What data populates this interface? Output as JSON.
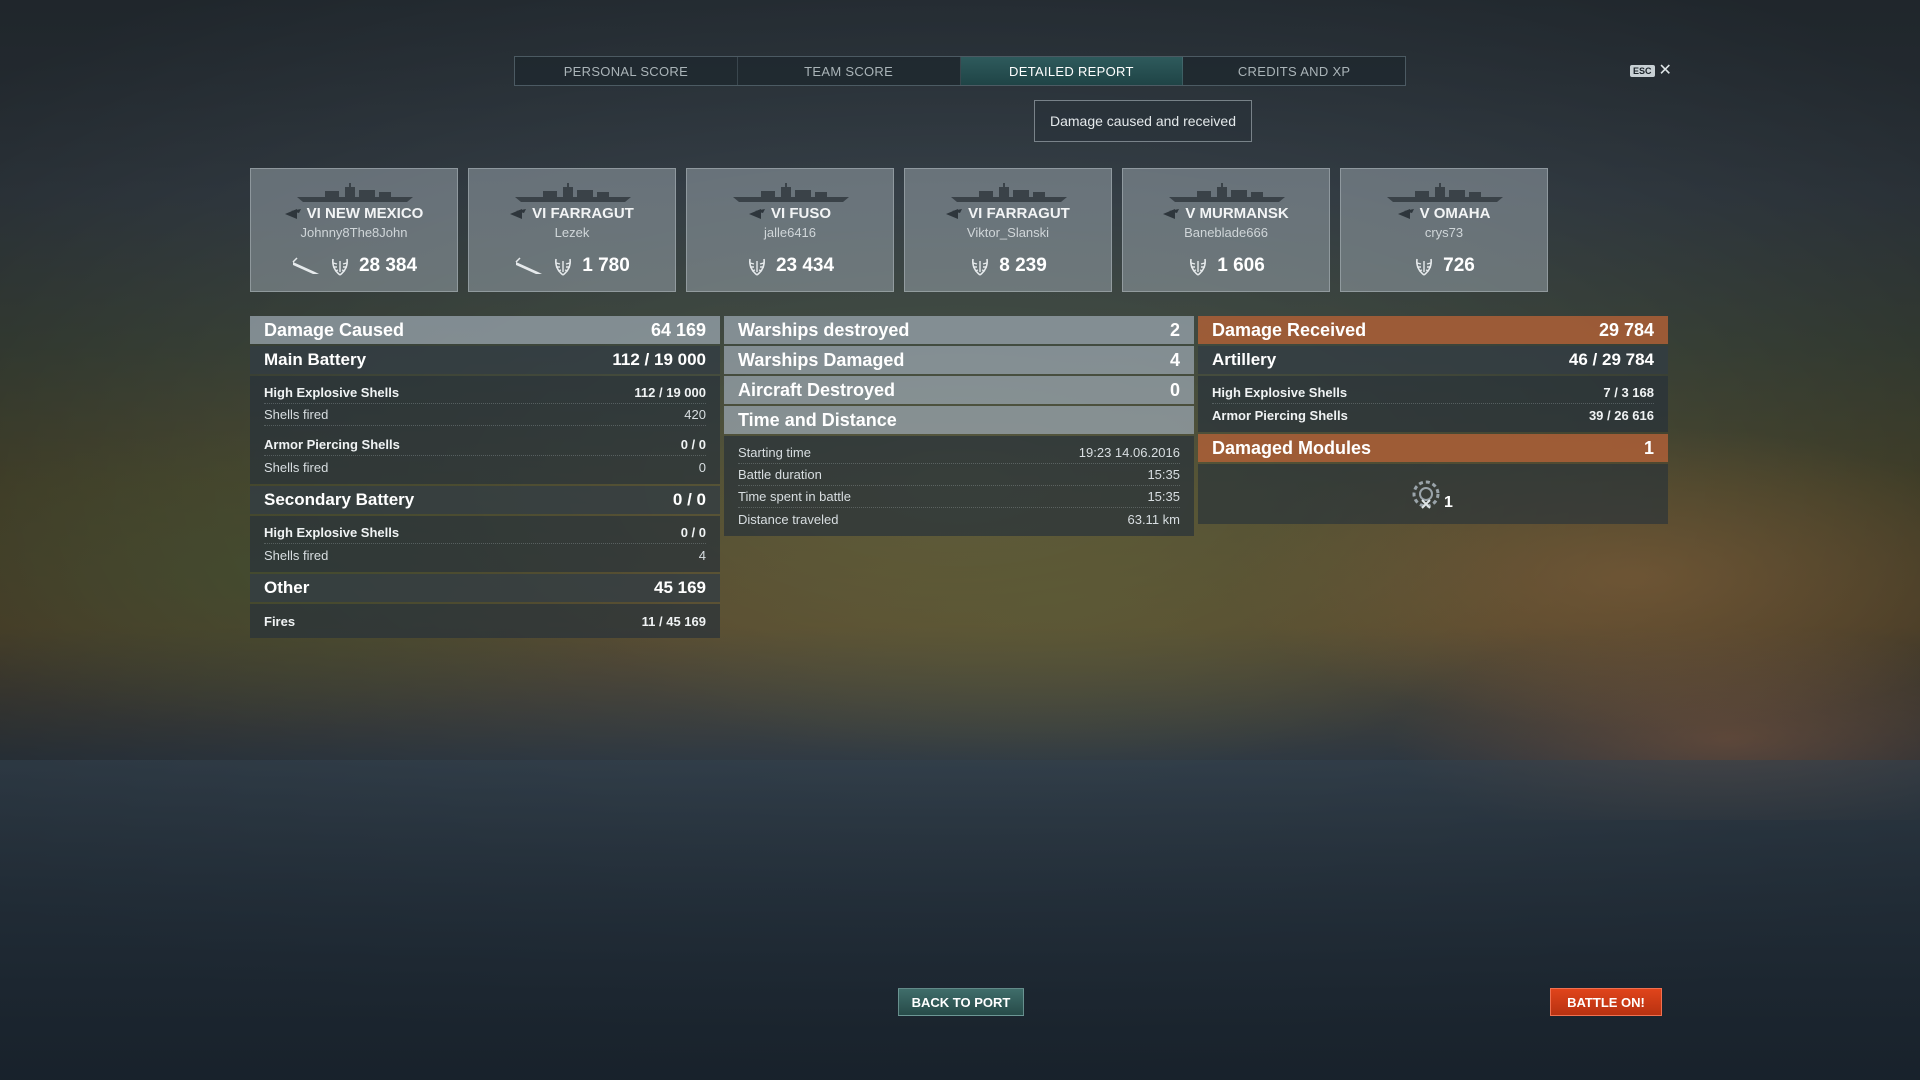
{
  "tabs": [
    {
      "label": "PERSONAL SCORE",
      "active": false
    },
    {
      "label": "TEAM SCORE",
      "active": false
    },
    {
      "label": "DETAILED REPORT",
      "active": true
    },
    {
      "label": "CREDITS AND XP",
      "active": false
    }
  ],
  "esc": {
    "key": "ESC",
    "close": "✕"
  },
  "subtitle": "Damage caused and received",
  "ships": [
    {
      "name": "VI NEW MEXICO",
      "player": "Johnny8The8John",
      "score": "28 384",
      "torpedo": true,
      "class": "battleship"
    },
    {
      "name": "VI FARRAGUT",
      "player": "Lezek",
      "score": "1 780",
      "torpedo": true,
      "class": "destroyer"
    },
    {
      "name": "VI FUSO",
      "player": "jalle6416",
      "score": "23 434",
      "torpedo": false,
      "class": "battleship"
    },
    {
      "name": "VI FARRAGUT",
      "player": "Viktor_Slanski",
      "score": "8 239",
      "torpedo": false,
      "class": "destroyer"
    },
    {
      "name": "V MURMANSK",
      "player": "Baneblade666",
      "score": "1 606",
      "torpedo": false,
      "class": "cruiser"
    },
    {
      "name": "V OMAHA",
      "player": "crys73",
      "score": "726",
      "torpedo": false,
      "class": "cruiser"
    }
  ],
  "damage_caused": {
    "title": "Damage Caused",
    "total": "64 169",
    "main_battery": {
      "title": "Main Battery",
      "value": "112 / 19 000",
      "he_label": "High Explosive Shells",
      "he_value": "112 / 19 000",
      "he_fired_label": "Shells fired",
      "he_fired_value": "420",
      "ap_label": "Armor Piercing Shells",
      "ap_value": "0 / 0",
      "ap_fired_label": "Shells fired",
      "ap_fired_value": "0"
    },
    "secondary": {
      "title": "Secondary Battery",
      "value": "0 / 0",
      "he_label": "High Explosive Shells",
      "he_value": "0 / 0",
      "fired_label": "Shells fired",
      "fired_value": "4"
    },
    "other": {
      "title": "Other",
      "value": "45 169",
      "fires_label": "Fires",
      "fires_value": "11 / 45 169"
    }
  },
  "middle": {
    "warships_destroyed_label": "Warships destroyed",
    "warships_destroyed_value": "2",
    "warships_damaged_label": "Warships Damaged",
    "warships_damaged_value": "4",
    "aircraft_destroyed_label": "Aircraft Destroyed",
    "aircraft_destroyed_value": "0",
    "time_title": "Time and Distance",
    "starting_time_label": "Starting time",
    "starting_time_value": "19:23  14.06.2016",
    "battle_duration_label": "Battle duration",
    "battle_duration_value": "15:35",
    "time_in_battle_label": "Time spent in battle",
    "time_in_battle_value": "15:35",
    "distance_label": "Distance traveled",
    "distance_value": "63.11 km"
  },
  "damage_received": {
    "title": "Damage Received",
    "total": "29 784",
    "artillery_title": "Artillery",
    "artillery_value": "46 / 29 784",
    "he_label": "High Explosive Shells",
    "he_value": "7 / 3 168",
    "ap_label": "Armor Piercing Shells",
    "ap_value": "39 / 26 616",
    "modules_title": "Damaged Modules",
    "modules_value": "1",
    "module_count": "1"
  },
  "buttons": {
    "back": "BACK TO PORT",
    "battle": "BATTLE ON!"
  }
}
